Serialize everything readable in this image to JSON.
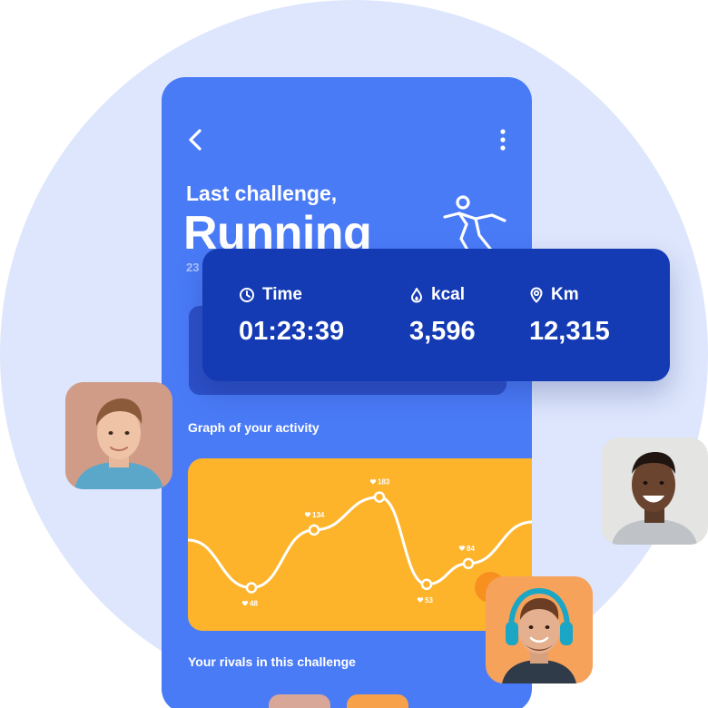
{
  "header": {
    "subtitle": "Last challenge,",
    "title": "Running",
    "date_partial": "23"
  },
  "icons": {
    "back": "chevron-left-icon",
    "more": "more-vertical-icon",
    "runner": "runner-icon",
    "time": "clock-icon",
    "kcal": "flame-icon",
    "km": "location-pin-icon",
    "point": "heart-icon"
  },
  "stats": {
    "time": {
      "label": "Time",
      "value": "01:23:39"
    },
    "kcal": {
      "label": "kcal",
      "value": "3,596"
    },
    "km": {
      "label": "Km",
      "value": "12,315"
    }
  },
  "graph": {
    "title": "Graph of your activity"
  },
  "chart_data": {
    "type": "line",
    "title": "Graph of your activity",
    "points": [
      {
        "value": 48,
        "label": "48"
      },
      {
        "value": 134,
        "label": "134"
      },
      {
        "value": 183,
        "label": "183"
      },
      {
        "value": 53,
        "label": "53"
      },
      {
        "value": 84,
        "label": "84"
      }
    ]
  },
  "rivals": {
    "title": "Your rivals in this challenge"
  },
  "colors": {
    "background_circle": "#dde6fc",
    "phone": "#4a7bf7",
    "stats_card": "#153bb4",
    "graph": "#fdb42b",
    "accent_orange": "#f7901e"
  }
}
